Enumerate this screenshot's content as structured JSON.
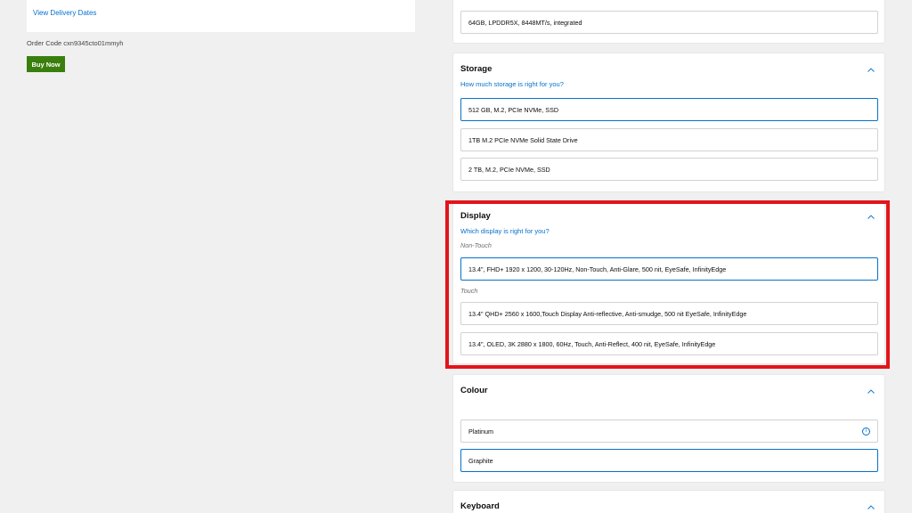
{
  "left": {
    "view_delivery_dates": "View Delivery Dates",
    "order_code": "Order Code cxn9345cto01mmyh",
    "buy_now": "Buy Now"
  },
  "memory": {
    "option": "64GB, LPDDR5X, 8448MT/s, integrated"
  },
  "storage": {
    "title": "Storage",
    "help_link": "How much storage is right for you?",
    "options": [
      "512 GB, M.2, PCIe NVMe, SSD",
      "1TB M.2 PCIe NVMe Solid State Drive",
      "2 TB, M.2, PCIe NVMe, SSD"
    ]
  },
  "display": {
    "title": "Display",
    "help_link": "Which display is right for you?",
    "group_non_touch": "Non-Touch",
    "group_touch": "Touch",
    "options": [
      "13.4\", FHD+ 1920 x 1200, 30-120Hz, Non-Touch, Anti-Glare, 500 nit, EyeSafe, InfinityEdge",
      "13.4\" QHD+ 2560 x 1600,Touch Display Anti-reflective, Anti-smudge, 500 nit EyeSafe, InfinityEdge",
      "13.4\", OLED, 3K 2880 x 1800, 60Hz, Touch, Anti-Reflect, 400 nit, EyeSafe, InfinityEdge"
    ]
  },
  "colour": {
    "title": "Colour",
    "options": [
      "Platinum",
      "Graphite"
    ],
    "info_icon": "i"
  },
  "keyboard": {
    "title": "Keyboard"
  },
  "colors": {
    "accent": "#0672cb",
    "buy_button": "#3a7f0d",
    "highlight": "#e3141b"
  },
  "icons": {
    "chevron": "chevron-up-icon",
    "info": "info-icon"
  }
}
